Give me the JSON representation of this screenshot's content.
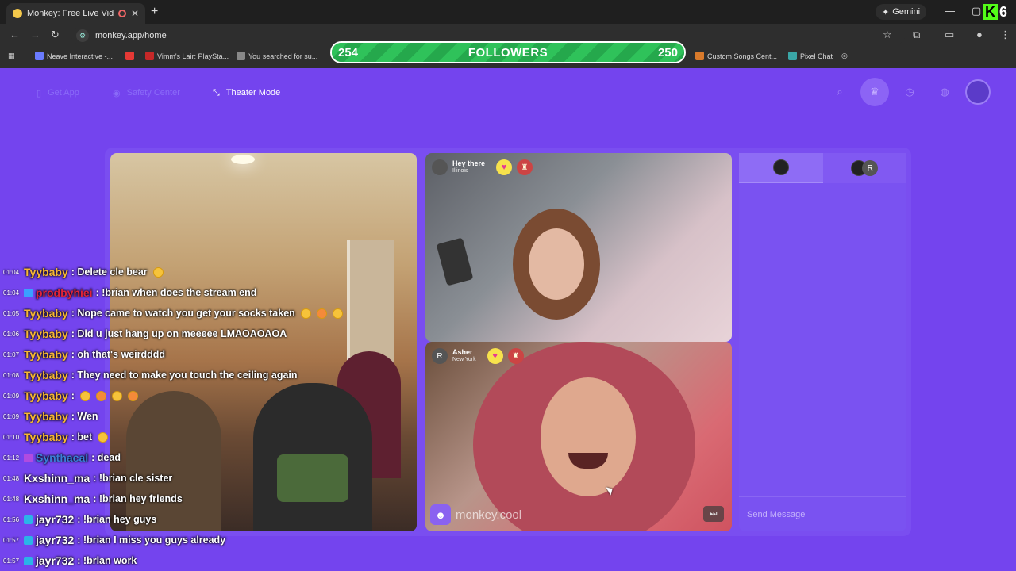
{
  "browser": {
    "tab_title": "Monkey: Free Live Video Ch",
    "gemini_label": "Gemini",
    "url": "monkey.app/home",
    "kick_badge": "6",
    "bookmarks": [
      {
        "label": "Neave Interactive -...",
        "color": "#6a7bff"
      },
      {
        "label": "Vimm's Lair: PlaySta...",
        "color": "#c62828"
      },
      {
        "label": "You searched for su...",
        "color": "#888888"
      },
      {
        "label": "Custom Songs Cent...",
        "color": "#d97a2b"
      },
      {
        "label": "Pixel Chat",
        "color": "#3aa6a6"
      }
    ]
  },
  "goal": {
    "current": "254",
    "label": "FOLLOWERS",
    "target": "250",
    "progress": 1.0
  },
  "site_header": {
    "get_app": "Get App",
    "safety_center": "Safety Center",
    "theater_mode": "Theater Mode"
  },
  "cams": {
    "top": {
      "avatar": "",
      "name": "Hey there",
      "location": "Illinois"
    },
    "bottom": {
      "avatar": "R",
      "name": "Asher",
      "location": "New York"
    }
  },
  "watermark": "monkey.cool",
  "chat_panel": {
    "tab2_avatar": "R",
    "send_placeholder": "Send Message"
  },
  "stream_chat": [
    {
      "time": "01:04",
      "user": "Tyybaby",
      "user_color": "#f7b733",
      "badge": "",
      "text": ": Delete cle bear",
      "emotes": 1
    },
    {
      "time": "01:04",
      "user": "prodbyhiei",
      "user_color": "#e0243a",
      "badge": "#3aa0ff",
      "text": ": !brian when does the stream end",
      "emotes": 0
    },
    {
      "time": "01:05",
      "user": "Tyybaby",
      "user_color": "#f7b733",
      "badge": "",
      "text": ": Nope came to watch you get your socks taken",
      "emotes": 3
    },
    {
      "time": "01:06",
      "user": "Tyybaby",
      "user_color": "#f7b733",
      "badge": "",
      "text": ": Did u just hang up on meeeee LMAOAOAOA",
      "emotes": 0
    },
    {
      "time": "01:07",
      "user": "Tyybaby",
      "user_color": "#f7b733",
      "badge": "",
      "text": ": oh that's weirdddd",
      "emotes": 0
    },
    {
      "time": "01:08",
      "user": "Tyybaby",
      "user_color": "#f7b733",
      "badge": "",
      "text": ": They need to make you touch the ceiling again",
      "emotes": 0
    },
    {
      "time": "01:09",
      "user": "Tyybaby",
      "user_color": "#f7b733",
      "badge": "",
      "text": ":",
      "emotes": 4
    },
    {
      "time": "01:09",
      "user": "Tyybaby",
      "user_color": "#f7b733",
      "badge": "",
      "text": ": Wen",
      "emotes": 0
    },
    {
      "time": "01:10",
      "user": "Tyybaby",
      "user_color": "#f7b733",
      "badge": "",
      "text": ": bet",
      "emotes": 1
    },
    {
      "time": "01:12",
      "user": "Synthacal",
      "user_color": "#3b7dd8",
      "badge": "#b04be0",
      "text": ": dead",
      "emotes": 0
    },
    {
      "time": "01:48",
      "user": "Kxshinn_ma",
      "user_color": "#ffffff",
      "badge": "",
      "text": ": !brian cle sister",
      "emotes": 0
    },
    {
      "time": "01:48",
      "user": "Kxshinn_ma",
      "user_color": "#ffffff",
      "badge": "",
      "text": ": !brian hey friends",
      "emotes": 0
    },
    {
      "time": "01:56",
      "user": "jayr732",
      "user_color": "#ffffff",
      "badge": "#2bb3e8",
      "text": ": !brian hey guys",
      "emotes": 0
    },
    {
      "time": "01:57",
      "user": "jayr732",
      "user_color": "#ffffff",
      "badge": "#2bb3e8",
      "text": ": !brian I miss you guys already",
      "emotes": 0
    },
    {
      "time": "01:57",
      "user": "jayr732",
      "user_color": "#ffffff",
      "badge": "#2bb3e8",
      "text": ": !brian work",
      "emotes": 0
    }
  ]
}
